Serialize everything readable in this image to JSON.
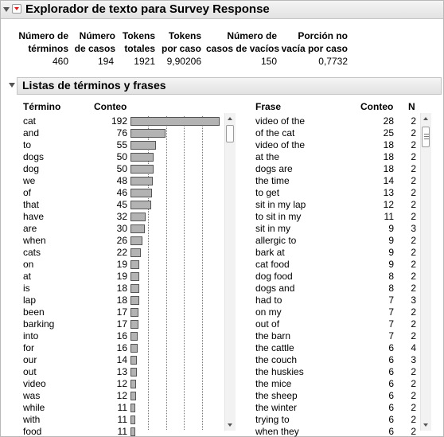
{
  "header": {
    "title": "Explorador de texto para Survey Response"
  },
  "stats": {
    "columns": [
      {
        "line1": "Número de",
        "line2": "términos",
        "value": "460"
      },
      {
        "line1": "Número",
        "line2": "de casos",
        "value": "194"
      },
      {
        "line1": "Tokens",
        "line2": "totales",
        "value": "1921"
      },
      {
        "line1": "Tokens",
        "line2": "por caso",
        "value": "9,90206"
      },
      {
        "line1": "Número de",
        "line2": "casos de vacíos",
        "value": "150"
      },
      {
        "line1": "Porción no",
        "line2": "vacía por caso",
        "value": "0,7732"
      }
    ]
  },
  "section": {
    "title": "Listas de términos y frases"
  },
  "terms": {
    "header_term": "Término",
    "header_count": "Conteo",
    "max": 192,
    "rows": [
      {
        "term": "cat",
        "count": 192
      },
      {
        "term": "and",
        "count": 76
      },
      {
        "term": "to",
        "count": 55
      },
      {
        "term": "dogs",
        "count": 50
      },
      {
        "term": "dog",
        "count": 50
      },
      {
        "term": "we",
        "count": 48
      },
      {
        "term": "of",
        "count": 46
      },
      {
        "term": "that",
        "count": 45
      },
      {
        "term": "have",
        "count": 32
      },
      {
        "term": "are",
        "count": 30
      },
      {
        "term": "when",
        "count": 26
      },
      {
        "term": "cats",
        "count": 22
      },
      {
        "term": "on",
        "count": 19
      },
      {
        "term": "at",
        "count": 19
      },
      {
        "term": "is",
        "count": 18
      },
      {
        "term": "lap",
        "count": 18
      },
      {
        "term": "been",
        "count": 17
      },
      {
        "term": "barking",
        "count": 17
      },
      {
        "term": "into",
        "count": 16
      },
      {
        "term": "for",
        "count": 16
      },
      {
        "term": "our",
        "count": 14
      },
      {
        "term": "out",
        "count": 13
      },
      {
        "term": "video",
        "count": 12
      },
      {
        "term": "was",
        "count": 12
      },
      {
        "term": "while",
        "count": 11
      },
      {
        "term": "with",
        "count": 11
      },
      {
        "term": "food",
        "count": 11
      }
    ]
  },
  "phrases": {
    "header_phrase": "Frase",
    "header_count": "Conteo",
    "header_n": "N",
    "rows": [
      {
        "phrase": "video of the",
        "count": 28,
        "n": 2
      },
      {
        "phrase": "of the cat",
        "count": 25,
        "n": 2
      },
      {
        "phrase": "video of the",
        "count": 18,
        "n": 2
      },
      {
        "phrase": "at the",
        "count": 18,
        "n": 2
      },
      {
        "phrase": "dogs are",
        "count": 18,
        "n": 2
      },
      {
        "phrase": "the time",
        "count": 14,
        "n": 2
      },
      {
        "phrase": "to get",
        "count": 13,
        "n": 2
      },
      {
        "phrase": "sit in my lap",
        "count": 12,
        "n": 2
      },
      {
        "phrase": "to sit in my",
        "count": 11,
        "n": 2
      },
      {
        "phrase": "sit in my",
        "count": 9,
        "n": 3
      },
      {
        "phrase": "allergic to",
        "count": 9,
        "n": 2
      },
      {
        "phrase": "bark at",
        "count": 9,
        "n": 2
      },
      {
        "phrase": "cat food",
        "count": 9,
        "n": 2
      },
      {
        "phrase": "dog food",
        "count": 8,
        "n": 2
      },
      {
        "phrase": "dogs and",
        "count": 8,
        "n": 2
      },
      {
        "phrase": "had to",
        "count": 7,
        "n": 3
      },
      {
        "phrase": "on my",
        "count": 7,
        "n": 2
      },
      {
        "phrase": "out of",
        "count": 7,
        "n": 2
      },
      {
        "phrase": "the barn",
        "count": 7,
        "n": 2
      },
      {
        "phrase": "the cattle",
        "count": 6,
        "n": 4
      },
      {
        "phrase": "the couch",
        "count": 6,
        "n": 3
      },
      {
        "phrase": "the huskies",
        "count": 6,
        "n": 2
      },
      {
        "phrase": "the mice",
        "count": 6,
        "n": 2
      },
      {
        "phrase": "the sheep",
        "count": 6,
        "n": 2
      },
      {
        "phrase": "the winter",
        "count": 6,
        "n": 2
      },
      {
        "phrase": "trying to",
        "count": 6,
        "n": 2
      },
      {
        "phrase": "when they",
        "count": 6,
        "n": 2
      }
    ]
  }
}
